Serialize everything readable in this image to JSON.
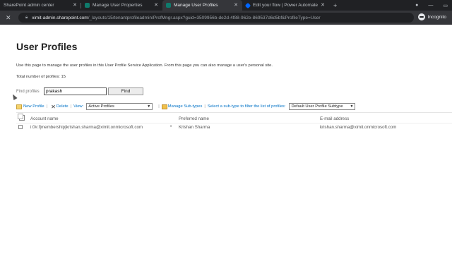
{
  "browser": {
    "tabs": [
      {
        "title": "SharePoint admin center",
        "active": false,
        "favicon_color": "#0f7b6c"
      },
      {
        "title": "Manage User Properties",
        "active": false,
        "favicon_color": "#0f7b6c"
      },
      {
        "title": "Manage User Profiles",
        "active": true,
        "favicon_color": "#0f7b6c"
      },
      {
        "title": "Edit your flow | Power Automate",
        "active": false,
        "favicon_color": "#0066ff"
      }
    ],
    "new_tab_icon": "+",
    "url_host": "ximit-admin.sharepoint.com",
    "url_rest": "/_layouts/15/tenantprofileadmin/ProfMngr.aspx?guid=3509956b-de2d-4f88-962e-869537d6d5bf&ProfileType=User",
    "incognito_label": "Incognito"
  },
  "page": {
    "title": "User Profiles",
    "description": "Use this page to manage the user profiles in this User Profile Service Application. From this page you can also manage a user's personal site.",
    "total_profiles": "Total number of profiles: 15",
    "find_label": "Find profiles",
    "find_value": "prakash",
    "find_button": "Find"
  },
  "actions": {
    "new_profile": "New Profile",
    "delete": "Delete",
    "view_label": "View:",
    "view_selected": "Active Profiles",
    "manage_subtypes": "Manage Sub-types",
    "subtype_filter_label": "Select a sub-type to filter the list of profiles:",
    "subtype_selected": "Default User Profile Subtype"
  },
  "table": {
    "columns": [
      "Account name",
      "Preferred name",
      "E-mail address"
    ],
    "rows": [
      {
        "account": "i:0#.f|membership|krishan.sharma@ximit.onmicrosoft.com",
        "preferred": "Krishan Sharma",
        "email": "krishan.sharma@ximit.onmicrosoft.com"
      }
    ]
  }
}
